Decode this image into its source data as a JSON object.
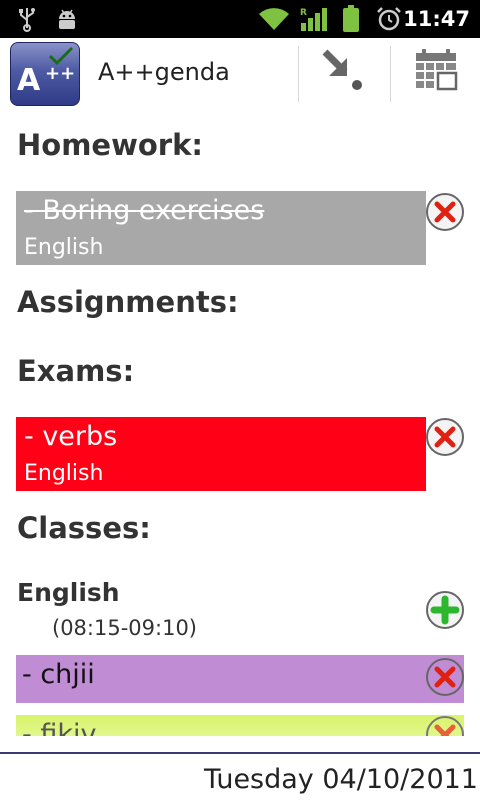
{
  "status_bar": {
    "time": "11:47",
    "icons": [
      "usb-icon",
      "android-debug-icon",
      "wifi-icon",
      "signal-roaming-icon",
      "battery-icon",
      "alarm-icon"
    ]
  },
  "action_bar": {
    "logo_text": "A",
    "logo_plus": "++",
    "app_title": "A++genda",
    "buttons": [
      "add-item-icon",
      "calendar-icon"
    ]
  },
  "sections": {
    "homework": "Homework:",
    "assignments": "Assignments:",
    "exams": "Exams:",
    "classes": "Classes:"
  },
  "homework_items": [
    {
      "title": "- Boring exercises",
      "subject": "English",
      "color": "#a8a8a8",
      "done": true
    }
  ],
  "exam_items": [
    {
      "title": "- verbs",
      "subject": "English",
      "color": "#ff0016"
    }
  ],
  "classes": [
    {
      "name": "English",
      "time": "(08:15-09:10)",
      "entries": [
        {
          "title": "- chjii",
          "color": "#c08cd4"
        },
        {
          "title": "- fikiv",
          "color": "#d8f46a"
        }
      ]
    }
  ],
  "footer": {
    "date": "Tuesday 04/10/2011"
  },
  "colors": {
    "delete": "#e02010",
    "add": "#2cb82c",
    "footer_line": "#3b3b6d"
  }
}
